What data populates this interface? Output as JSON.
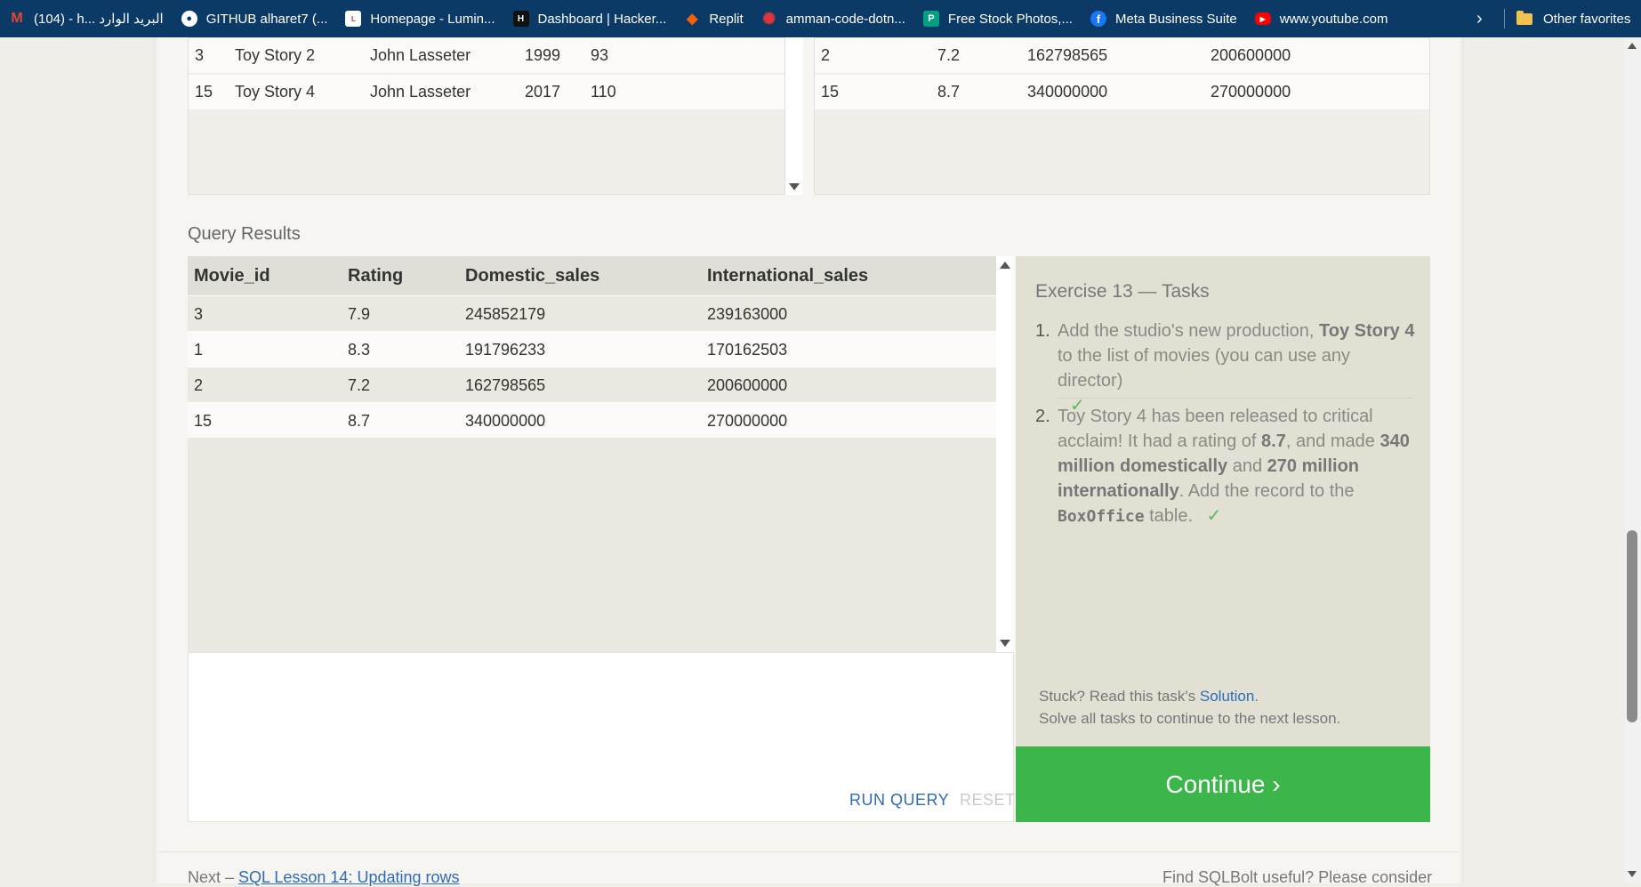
{
  "bookmarks": [
    {
      "label": "(104) - h... البريد الوارد",
      "icon": "gmail-icon",
      "color": "#ea4335",
      "glyph": "M"
    },
    {
      "label": "GITHUB alharet7 (...",
      "icon": "github-icon",
      "color": "#ffffff",
      "glyph": "●"
    },
    {
      "label": "Homepage - Lumin...",
      "icon": "luminus-icon",
      "color": "#ffffff",
      "glyph": "L"
    },
    {
      "label": "Dashboard | Hacker...",
      "icon": "hackerrank-icon",
      "color": "#1ba94c",
      "glyph": "H"
    },
    {
      "label": "Replit",
      "icon": "replit-icon",
      "color": "#f26207",
      "glyph": "◆"
    },
    {
      "label": "amman-code-dotn...",
      "icon": "code-icon",
      "color": "#e0353b",
      "glyph": "✺"
    },
    {
      "label": "Free Stock Photos,...",
      "icon": "pexels-icon",
      "color": "#05a081",
      "glyph": "P"
    },
    {
      "label": "Meta Business Suite",
      "icon": "facebook-icon",
      "color": "#1877f2",
      "glyph": "f"
    },
    {
      "label": "www.youtube.com",
      "icon": "youtube-icon",
      "color": "#ff0000",
      "glyph": "▶"
    }
  ],
  "bookmarks_other": "Other favorites",
  "movies_table": {
    "rows": [
      [
        "3",
        "Toy Story 2",
        "John Lasseter",
        "1999",
        "93"
      ],
      [
        "15",
        "Toy Story 4",
        "John Lasseter",
        "2017",
        "110"
      ]
    ]
  },
  "boxoffice_table": {
    "rows": [
      [
        "2",
        "7.2",
        "162798565",
        "200600000"
      ],
      [
        "15",
        "8.7",
        "340000000",
        "270000000"
      ]
    ]
  },
  "query_results": {
    "title": "Query Results",
    "columns": [
      "Movie_id",
      "Rating",
      "Domestic_sales",
      "International_sales"
    ],
    "rows": [
      [
        "3",
        "7.9",
        "245852179",
        "239163000"
      ],
      [
        "1",
        "8.3",
        "191796233",
        "170162503"
      ],
      [
        "2",
        "7.2",
        "162798565",
        "200600000"
      ],
      [
        "15",
        "8.7",
        "340000000",
        "270000000"
      ]
    ]
  },
  "editor": {
    "run_label": "RUN QUERY",
    "reset_label": "RESET"
  },
  "tasks": {
    "title": "Exercise 13 — Tasks",
    "task1": {
      "num": "1.",
      "pre": "Add the studio's new production, ",
      "bold": "Toy Story 4",
      "post": " to the list of movies (you can use any director)",
      "check": "✓"
    },
    "task2": {
      "num": "2.",
      "t1": "Toy Story 4 has been released to critical acclaim! It had a rating of ",
      "b1": "8.7",
      "t2": ", and made ",
      "b2": "340 million domestically",
      "t3": " and ",
      "b3": "270 million internationally",
      "t4": ". Add the record to the ",
      "code": "BoxOffice",
      "t5": " table.",
      "check": "✓"
    },
    "stuck_pre": "Stuck? Read this task's ",
    "solution_label": "Solution",
    "stuck_post": ".",
    "solve_all": "Solve all tasks to continue to the next lesson."
  },
  "continue_label": "Continue ›",
  "footer": {
    "next_pre": "Next – ",
    "next_link": "SQL Lesson 14: Updating rows",
    "find_text": "Find SQLBolt useful? Please consider"
  }
}
